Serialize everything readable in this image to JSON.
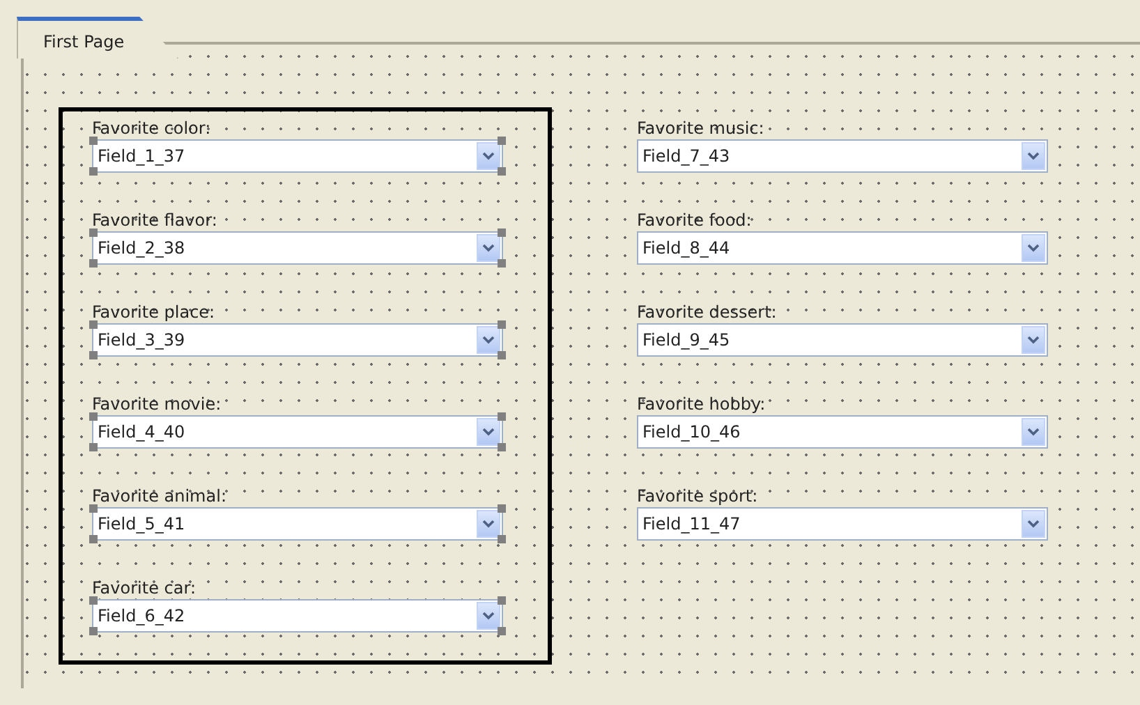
{
  "tabs": [
    {
      "label": "First Page",
      "selected": true
    }
  ],
  "columns": [
    {
      "framed": true,
      "fields": [
        {
          "label": "Favorite color:",
          "value": "Field_1_37",
          "selected": true
        },
        {
          "label": "Favorite flavor:",
          "value": "Field_2_38",
          "selected": true
        },
        {
          "label": "Favorite place:",
          "value": "Field_3_39",
          "selected": true
        },
        {
          "label": "Favorite movie:",
          "value": "Field_4_40",
          "selected": true
        },
        {
          "label": "Favorite animal:",
          "value": "Field_5_41",
          "selected": true
        },
        {
          "label": "Favorite car:",
          "value": "Field_6_42",
          "selected": true
        }
      ]
    },
    {
      "framed": false,
      "fields": [
        {
          "label": "Favorite music:",
          "value": "Field_7_43",
          "selected": false
        },
        {
          "label": "Favorite food:",
          "value": "Field_8_44",
          "selected": false
        },
        {
          "label": "Favorite dessert:",
          "value": "Field_9_45",
          "selected": false
        },
        {
          "label": "Favorite hobby:",
          "value": "Field_10_46",
          "selected": false
        },
        {
          "label": "Favorite sport:",
          "value": "Field_11_47",
          "selected": false
        }
      ]
    }
  ]
}
